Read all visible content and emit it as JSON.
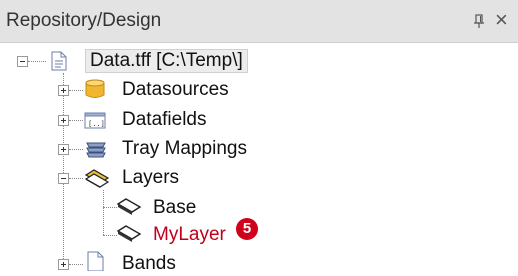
{
  "panel": {
    "title": "Repository/Design",
    "pin_icon": "pin-icon",
    "close_label": "×"
  },
  "tree": {
    "root": {
      "label": "Data.tff [C:\\Temp\\]",
      "icon": "document-icon",
      "expanded": true,
      "selected": true
    },
    "items": [
      {
        "label": "Datasources",
        "icon": "database-icon",
        "expanded": false
      },
      {
        "label": "Datafields",
        "icon": "datafield-icon",
        "expanded": false
      },
      {
        "label": "Tray Mappings",
        "icon": "tray-icon",
        "expanded": false
      },
      {
        "label": "Layers",
        "icon": "layers-icon",
        "expanded": true,
        "children": [
          {
            "label": "Base",
            "icon": "layer-icon"
          },
          {
            "label": "MyLayer",
            "icon": "layer-icon",
            "color": "#c0001a"
          }
        ]
      },
      {
        "label": "Bands",
        "icon": "page-icon",
        "expanded": false
      }
    ]
  },
  "callout": {
    "number": "5",
    "color": "#d0021b"
  }
}
